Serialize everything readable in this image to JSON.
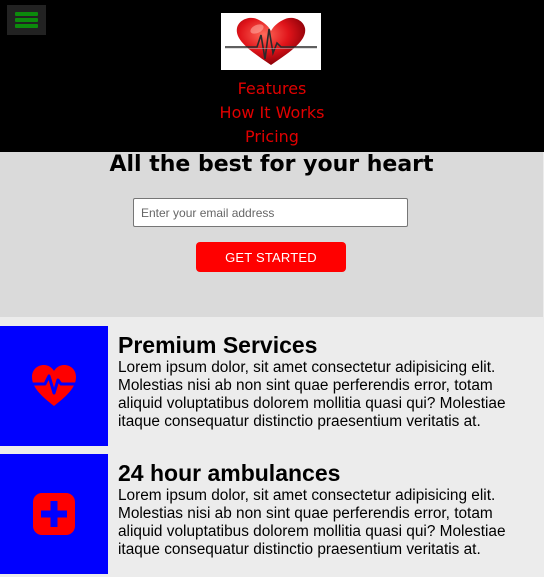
{
  "header": {
    "menu_icon": "hamburger-menu-icon",
    "logo_icon": "heart-pulse-logo-icon",
    "nav": [
      {
        "label": "Features"
      },
      {
        "label": "How It Works"
      },
      {
        "label": "Pricing"
      }
    ]
  },
  "hero": {
    "title": "All the best for your heart",
    "email_placeholder": "Enter your email address",
    "cta_label": "GET STARTED"
  },
  "features": [
    {
      "icon": "heartbeat-icon",
      "title": "Premium Services",
      "text": "Lorem ipsum dolor, sit amet consectetur adipisicing elit. Molestias nisi ab non sint quae perferendis error, totam aliquid voluptatibus dolorem mollitia quasi qui? Molestiae itaque consequatur distinctio praesentium veritatis at."
    },
    {
      "icon": "medical-cross-icon",
      "title": "24 hour ambulances",
      "text": "Lorem ipsum dolor, sit amet consectetur adipisicing elit. Molestias nisi ab non sint quae perferendis error, totam aliquid voluptatibus dolorem mollitia quasi qui? Molestiae itaque consequatur distinctio praesentium veritatis at."
    }
  ],
  "colors": {
    "header_bg": "#000000",
    "nav_link": "#e10000",
    "menu_icon": "#0c8a0c",
    "hero_bg": "#dadada",
    "cta_bg": "#ff0000",
    "feature_icon_bg": "#0000ff",
    "feature_icon": "#ff0000"
  }
}
